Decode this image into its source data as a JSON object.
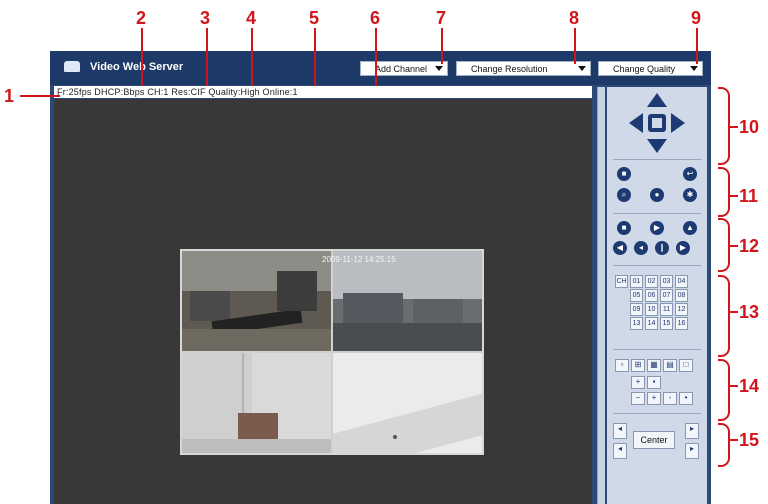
{
  "window": {
    "title": "Video Web Server",
    "buttons": {
      "add_channel": "Add Channel",
      "change_resolution": "Change Resolution",
      "change_quality": "Change Quality"
    },
    "info_bar": "Fr:25fps  DHCP:Bbps  CH:1  Res:CIF  Quality:High  Online:1"
  },
  "video": {
    "timestamp": "2009-11-12 14:25:15"
  },
  "panel": {
    "channel_label": "CH",
    "channels": [
      "01",
      "02",
      "03",
      "04",
      "05",
      "06",
      "07",
      "08",
      "09",
      "10",
      "11",
      "12",
      "13",
      "14",
      "15",
      "16"
    ],
    "center_label": "Center"
  },
  "annotations": [
    "1",
    "2",
    "3",
    "4",
    "5",
    "6",
    "7",
    "8",
    "9",
    "10",
    "11",
    "12",
    "13",
    "14",
    "15"
  ],
  "colors": {
    "annotation": "#d0161b",
    "frame": "#2c4a78",
    "titlebar": "#1d3a68",
    "viewer": "#383838",
    "panel": "#cfd9e8",
    "control": "#1e3a73"
  }
}
